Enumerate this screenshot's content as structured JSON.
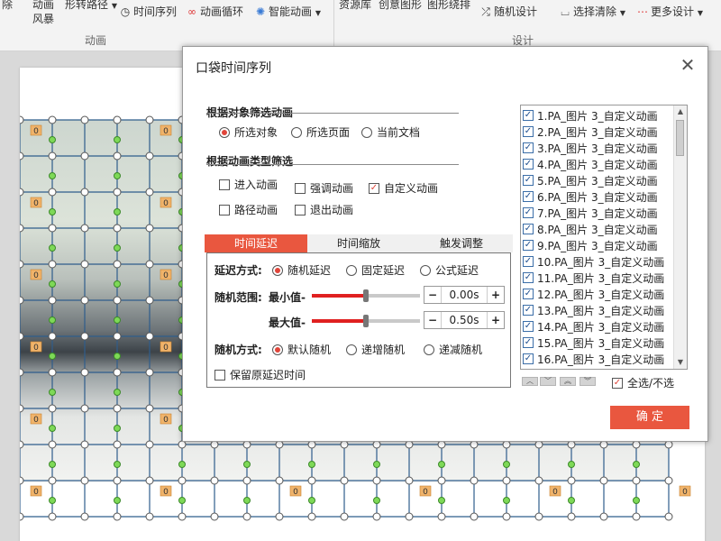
{
  "ribbon": {
    "items": [
      {
        "label": "除",
        "icon": "remove-icon"
      },
      {
        "label": "动画",
        "icon": ""
      },
      {
        "label": "风暴",
        "icon": ""
      },
      {
        "label": "形转路径",
        "icon": ""
      },
      {
        "label": "时间序列",
        "icon": "clock-icon"
      },
      {
        "label": "动画循环",
        "icon": "loop-icon"
      },
      {
        "label": "智能动画",
        "icon": "bulb-icon"
      },
      {
        "label": "资源库",
        "icon": ""
      },
      {
        "label": "创意图形",
        "icon": ""
      },
      {
        "label": "图形绕排",
        "icon": ""
      },
      {
        "label": "随机设计",
        "icon": "shuffle-icon"
      },
      {
        "label": "选择清除",
        "icon": "clear-icon"
      },
      {
        "label": "更多设计",
        "icon": "more-icon"
      }
    ],
    "group_animation": "动画",
    "group_design": "设计"
  },
  "dialog": {
    "title": "口袋时间序列",
    "filter_object": {
      "heading": "根据对象筛选动画",
      "options": [
        "所选对象",
        "所选页面",
        "当前文档"
      ],
      "selected": "所选对象"
    },
    "filter_type": {
      "heading": "根据动画类型筛选",
      "options": [
        {
          "label": "进入动画",
          "checked": false
        },
        {
          "label": "强调动画",
          "checked": false
        },
        {
          "label": "自定义动画",
          "checked": true
        },
        {
          "label": "路径动画",
          "checked": false
        },
        {
          "label": "退出动画",
          "checked": false
        }
      ]
    },
    "tabs": [
      "时间延迟",
      "时间缩放",
      "触发调整"
    ],
    "active_tab": "时间延迟",
    "delay_mode": {
      "label": "延迟方式:",
      "options": [
        "随机延迟",
        "固定延迟",
        "公式延迟"
      ],
      "selected": "随机延迟"
    },
    "range": {
      "label": "随机范围:",
      "min_label": "最小值-",
      "min_value": "0.00s",
      "min_position": 0.5,
      "max_label": "最大值-",
      "max_value": "0.50s",
      "max_position": 0.5,
      "minus": "−",
      "plus": "+"
    },
    "random_mode": {
      "label": "随机方式:",
      "options": [
        "默认随机",
        "递增随机",
        "递减随机"
      ],
      "selected": "默认随机"
    },
    "keep_delay": {
      "label": "保留原延迟时间",
      "checked": false
    },
    "animation_list": [
      "1.PA_图片 3_自定义动画",
      "2.PA_图片 3_自定义动画",
      "3.PA_图片 3_自定义动画",
      "4.PA_图片 3_自定义动画",
      "5.PA_图片 3_自定义动画",
      "6.PA_图片 3_自定义动画",
      "7.PA_图片 3_自定义动画",
      "8.PA_图片 3_自定义动画",
      "9.PA_图片 3_自定义动画",
      "10.PA_图片 3_自定义动画",
      "11.PA_图片 3_自定义动画",
      "12.PA_图片 3_自定义动画",
      "13.PA_图片 3_自定义动画",
      "14.PA_图片 3_自定义动画",
      "15.PA_图片 3_自定义动画",
      "16.PA_图片 3_自定义动画"
    ],
    "select_all": {
      "label": "全选/不选",
      "checked": true
    },
    "ok_label": "确 定"
  },
  "slide": {
    "badge_text": "0"
  },
  "colors": {
    "accent": "#e9573f",
    "slider_fill": "#e02020",
    "badge": "#f0b36a"
  }
}
